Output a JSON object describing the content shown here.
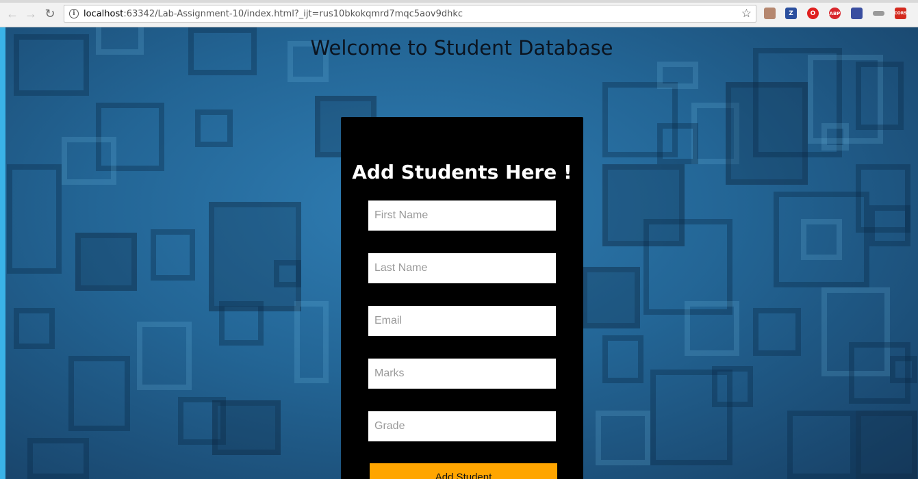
{
  "browser": {
    "url_host": "localhost",
    "url_rest": ":63342/Lab-Assignment-10/index.html?_ijt=rus10bkokqmrd7mqc5aov9dhkc",
    "back_icon": "arrow-left-icon",
    "forward_icon": "arrow-right-icon",
    "reload_icon": "reload-icon",
    "extensions": [
      {
        "name": "pdf-extension-icon",
        "label": "",
        "color": "#b5876f"
      },
      {
        "name": "zotero-extension-icon",
        "label": "Z",
        "color": "#2b4f9e"
      },
      {
        "name": "opera-extension-icon",
        "label": "O",
        "color": "#e0201f"
      },
      {
        "name": "adblock-extension-icon",
        "label": "ABP",
        "color": "#d8262c"
      },
      {
        "name": "flag-extension-icon",
        "label": "",
        "color": "#3a4ea0"
      },
      {
        "name": "gray-extension-icon",
        "label": "",
        "color": "#9a9a9a"
      },
      {
        "name": "cors-extension-icon",
        "label": "CORS",
        "color": "#d42a1e"
      }
    ]
  },
  "page": {
    "welcome": "Welcome to Student Database"
  },
  "form": {
    "title": "Add Students Here !",
    "first_name_placeholder": "First Name",
    "last_name_placeholder": "Last Name",
    "email_placeholder": "Email",
    "marks_placeholder": "Marks",
    "grade_placeholder": "Grade",
    "submit_label": "Add Student"
  },
  "colors": {
    "accent": "#ffa500",
    "card": "#000000",
    "background": "#236595"
  }
}
